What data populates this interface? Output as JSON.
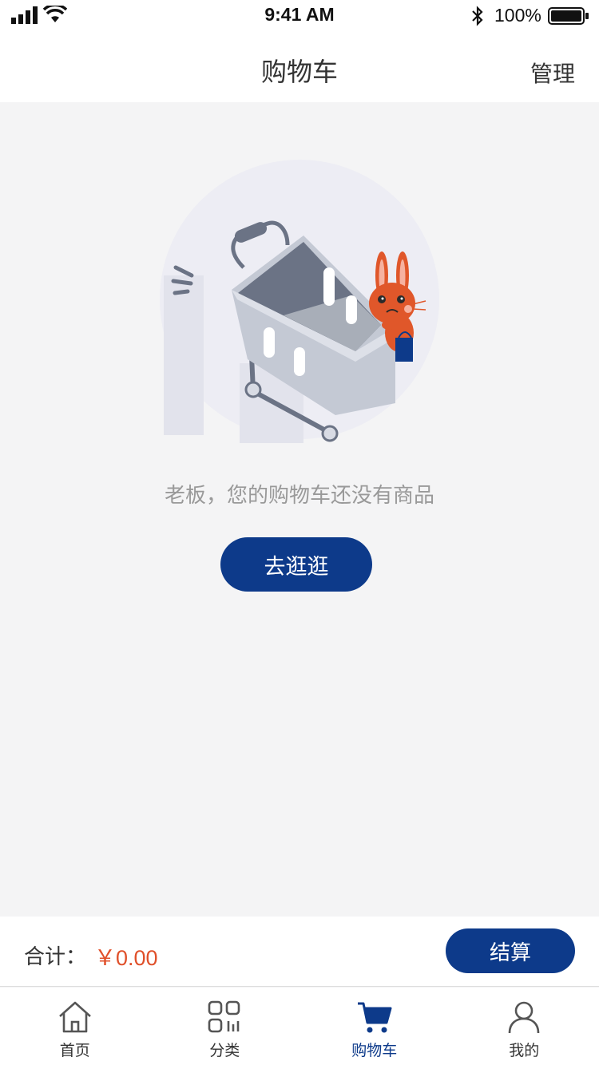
{
  "status_bar": {
    "time": "9:41 AM",
    "battery": "100%"
  },
  "header": {
    "title": "购物车",
    "manage": "管理"
  },
  "empty_state": {
    "message": "老板，您的购物车还没有商品",
    "button": "去逛逛"
  },
  "checkout": {
    "total_label": "合计：",
    "total_value": "￥0.00",
    "button": "结算"
  },
  "tabs": [
    {
      "label": "首页",
      "icon": "home-icon"
    },
    {
      "label": "分类",
      "icon": "category-icon"
    },
    {
      "label": "购物车",
      "icon": "cart-icon",
      "active": true
    },
    {
      "label": "我的",
      "icon": "user-icon"
    }
  ],
  "colors": {
    "primary": "#0d3a8a",
    "price": "#e0502a",
    "background": "#f4f4f5"
  }
}
